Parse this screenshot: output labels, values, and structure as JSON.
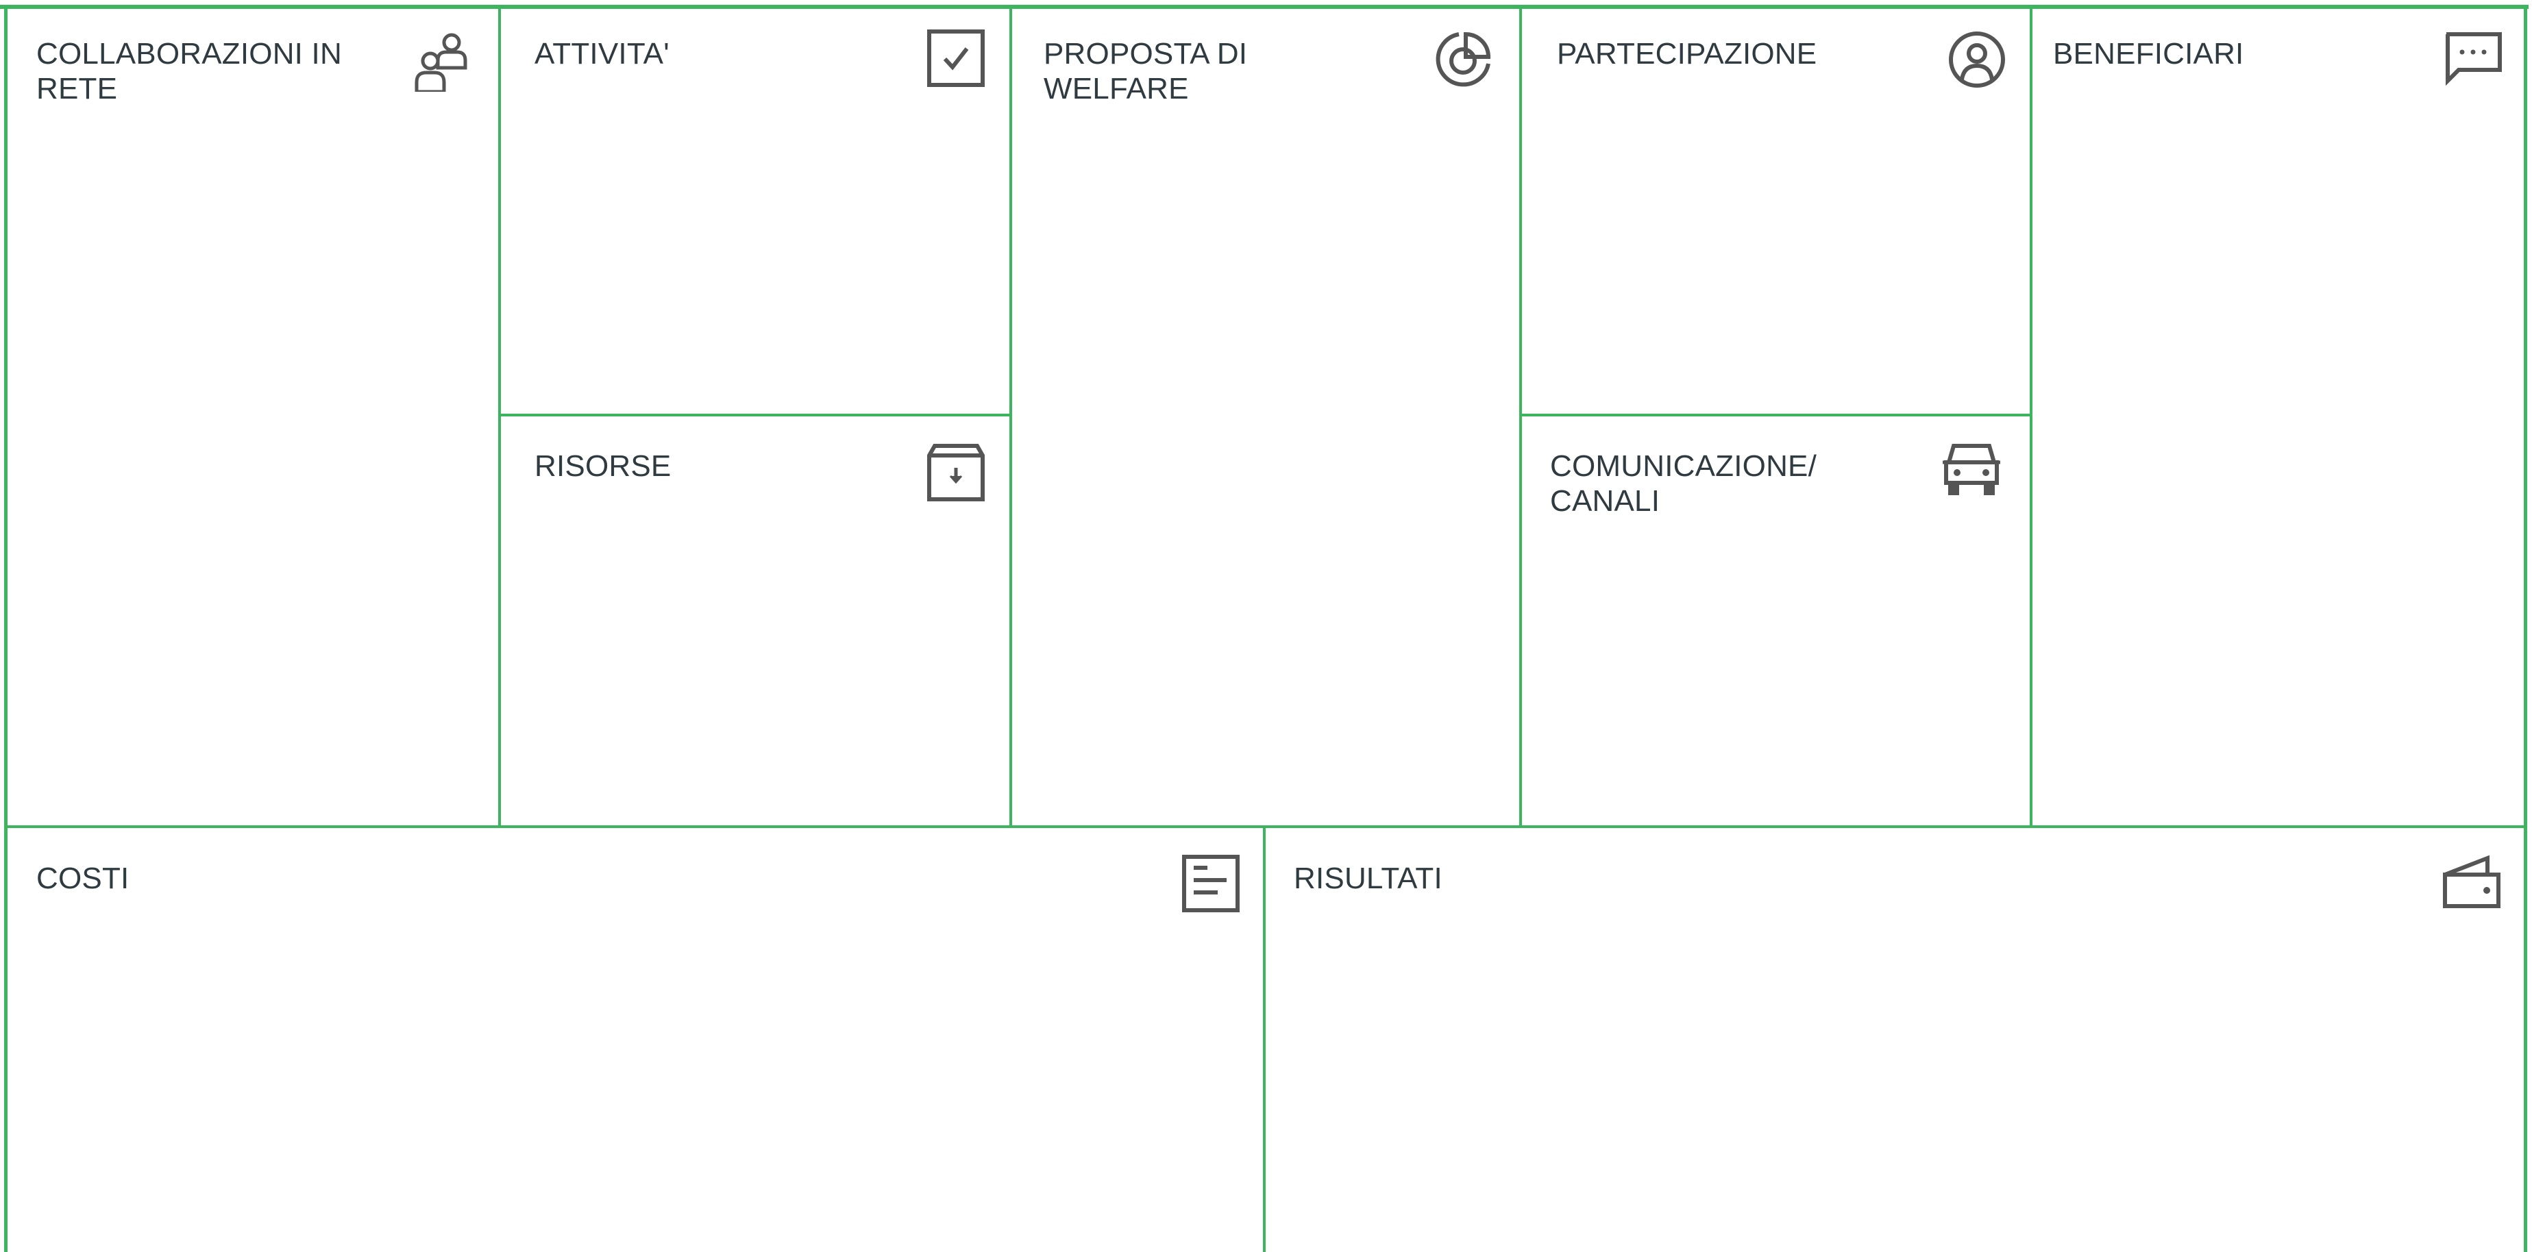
{
  "canvas": {
    "border_color": "#3cb55e",
    "text_color": "#2f3b40",
    "icon_color": "#555555"
  },
  "blocks": {
    "collaborazioni": {
      "title": "COLLABORAZIONI IN\nRETE",
      "icon": "people-icon"
    },
    "attivita": {
      "title": "ATTIVITA'",
      "icon": "checkbox-icon"
    },
    "risorse": {
      "title": "RISORSE",
      "icon": "archive-box-icon"
    },
    "proposta": {
      "title": "PROPOSTA DI\nWELFARE",
      "icon": "pie-chart-icon"
    },
    "partecipazione": {
      "title": "PARTECIPAZIONE",
      "icon": "user-circle-icon"
    },
    "comunicazione": {
      "title": "COMUNICAZIONE/\nCANALI",
      "icon": "car-icon"
    },
    "beneficiari": {
      "title": "BENEFICIARI",
      "icon": "chat-bubble-icon"
    },
    "costi": {
      "title": "COSTI",
      "icon": "document-list-icon"
    },
    "risultati": {
      "title": "RISULTATI",
      "icon": "wallet-icon"
    }
  }
}
